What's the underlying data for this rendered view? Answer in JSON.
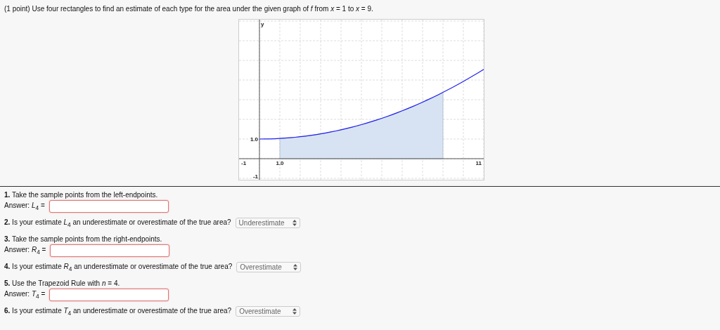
{
  "problem": {
    "text": "(1 point) Use four rectangles to find an estimate of each type for the area under the given graph of *f* from *x* = 1 to *x* = 9."
  },
  "graph": {
    "labels": [
      {
        "kind": "y-name",
        "text": "y"
      },
      {
        "kind": "y-tick",
        "text": "1.0"
      },
      {
        "kind": "x-min",
        "text": "-1"
      },
      {
        "kind": "x-tick",
        "text": "1.0"
      },
      {
        "kind": "x-max",
        "text": "11"
      },
      {
        "kind": "y-min",
        "text": "-1"
      }
    ]
  },
  "questions": [
    {
      "kind": "compute",
      "text": "**1.** Take the sample points from the left-endpoints.",
      "answer_label": "Answer: *L*$_{4}$ ="
    },
    {
      "kind": "judge",
      "text": "**2.** Is your estimate *L*$_{4}$ an underestimate or overestimate of the true area?",
      "choice": "Underestimate"
    },
    {
      "kind": "compute",
      "text": "**3.** Take the sample points from the right-endpoints.",
      "answer_label": "Answer: *R*$_{4}$ ="
    },
    {
      "kind": "judge",
      "text": "**4.** Is your estimate *R*$_{4}$ an underestimate or overestimate of the true area?",
      "choice": "Overestimate"
    },
    {
      "kind": "compute",
      "text": "**5.** Use the Trapezoid Rule with *n* = 4.",
      "answer_label": "Answer: *T*$_{4}$ ="
    },
    {
      "kind": "judge",
      "text": "**6.** Is your estimate *T*$_{4}$ an underestimate or overestimate of the true area?",
      "choice": "Overestimate"
    }
  ]
}
